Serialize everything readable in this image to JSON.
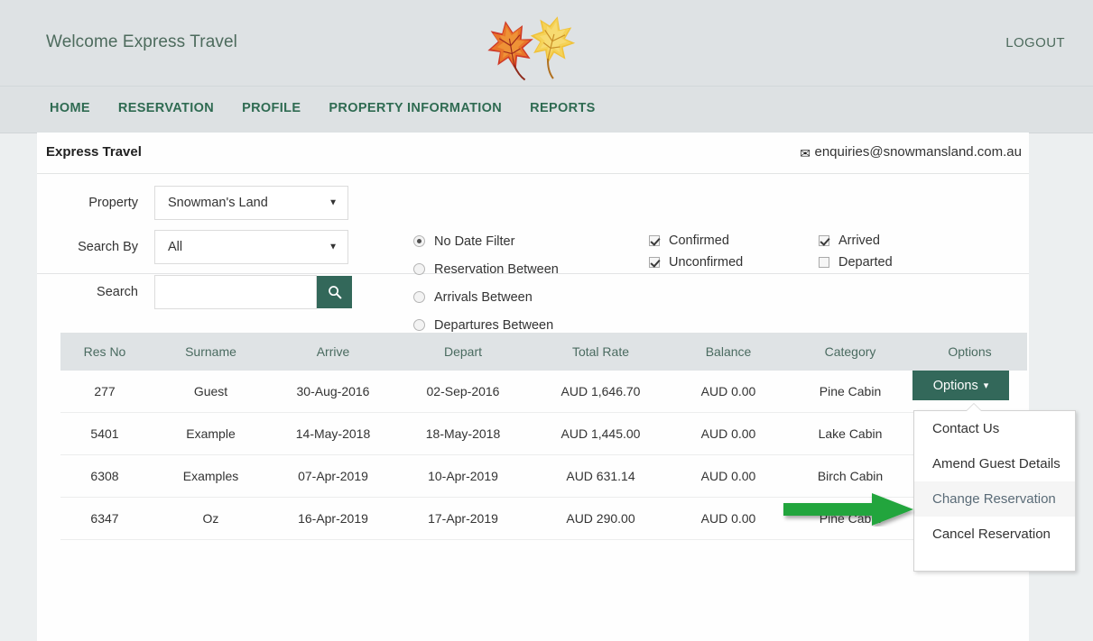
{
  "header": {
    "welcome": "Welcome Express Travel",
    "logout": "LOGOUT",
    "logo_icon": "autumn-leaves-logo"
  },
  "nav": {
    "items": [
      {
        "label": "HOME"
      },
      {
        "label": "RESERVATION"
      },
      {
        "label": "PROFILE"
      },
      {
        "label": "PROPERTY INFORMATION"
      },
      {
        "label": "REPORTS"
      }
    ]
  },
  "panel": {
    "title": "Express Travel",
    "email": "enquiries@snowmansland.com.au",
    "email_icon": "envelope-icon"
  },
  "filters": {
    "property_label": "Property",
    "property_value": "Snowman's Land",
    "search_by_label": "Search By",
    "search_by_value": "All",
    "search_label": "Search",
    "search_value": "",
    "search_placeholder": "",
    "search_icon": "search-icon",
    "date_filters": [
      {
        "label": "No Date Filter",
        "selected": true
      },
      {
        "label": "Reservation Between",
        "selected": false
      },
      {
        "label": "Arrivals Between",
        "selected": false
      },
      {
        "label": "Departures Between",
        "selected": false
      }
    ],
    "status_col1": [
      {
        "label": "Confirmed",
        "checked": true
      },
      {
        "label": "Unconfirmed",
        "checked": true
      }
    ],
    "status_col2": [
      {
        "label": "Arrived",
        "checked": true
      },
      {
        "label": "Departed",
        "checked": false
      }
    ]
  },
  "table": {
    "columns": [
      "Res No",
      "Surname",
      "Arrive",
      "Depart",
      "Total Rate",
      "Balance",
      "Category",
      "Options"
    ],
    "rows": [
      {
        "res_no": "277",
        "surname": "Guest",
        "arrive": "30-Aug-2016",
        "depart": "02-Sep-2016",
        "total_rate": "AUD 1,646.70",
        "balance": "AUD 0.00",
        "category": "Pine Cabin",
        "options": "Options"
      },
      {
        "res_no": "5401",
        "surname": "Example",
        "arrive": "14-May-2018",
        "depart": "18-May-2018",
        "total_rate": "AUD 1,445.00",
        "balance": "AUD 0.00",
        "category": "Lake Cabin",
        "options": ""
      },
      {
        "res_no": "6308",
        "surname": "Examples",
        "arrive": "07-Apr-2019",
        "depart": "10-Apr-2019",
        "total_rate": "AUD 631.14",
        "balance": "AUD 0.00",
        "category": "Birch Cabin",
        "options": ""
      },
      {
        "res_no": "6347",
        "surname": "Oz",
        "arrive": "16-Apr-2019",
        "depart": "17-Apr-2019",
        "total_rate": "AUD 290.00",
        "balance": "AUD 0.00",
        "category": "Pine Cabin",
        "options": ""
      }
    ]
  },
  "options_menu": {
    "button_label": "Options",
    "items": [
      {
        "label": "Contact Us",
        "highlighted": false
      },
      {
        "label": "Amend Guest Details",
        "highlighted": false
      },
      {
        "label": "Change Reservation",
        "highlighted": true
      },
      {
        "label": "Cancel Reservation",
        "highlighted": false
      }
    ]
  },
  "annotation": {
    "arrow_icon": "green-right-arrow",
    "arrow_color": "#1aa33a"
  },
  "colors": {
    "brand_green": "#33685a",
    "nav_green": "#2f6b52",
    "header_bg": "#dee2e4",
    "page_bg": "#eceff0"
  }
}
